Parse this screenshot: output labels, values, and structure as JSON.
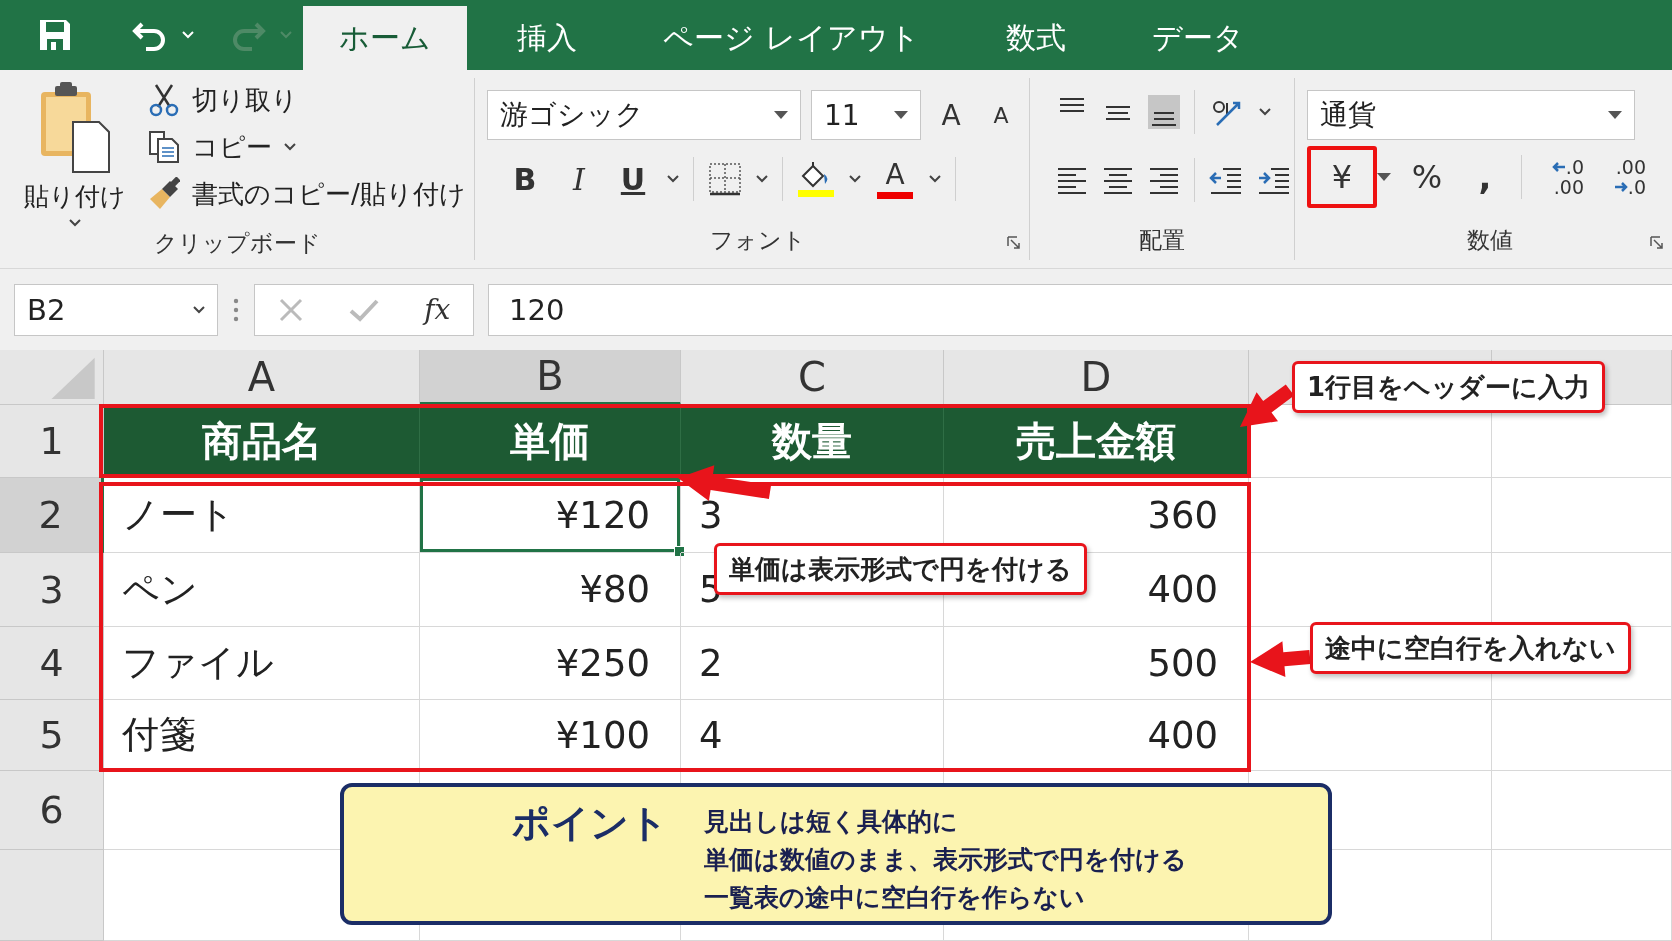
{
  "quick_access": [
    {
      "kind": "save",
      "disabled": false
    },
    {
      "kind": "undo",
      "disabled": false
    },
    {
      "kind": "redo",
      "disabled": true
    }
  ],
  "tabs": [
    {
      "label": "ホーム",
      "selected": true
    },
    {
      "label": "挿入",
      "selected": false
    },
    {
      "label": "ページ レイアウト",
      "selected": false
    },
    {
      "label": "数式",
      "selected": false
    },
    {
      "label": "データ",
      "selected": false
    }
  ],
  "ribbon": {
    "clipboard": {
      "paste": "貼り付け",
      "label": "クリップボード",
      "items": [
        {
          "kind": "cut",
          "label": "切り取り",
          "dropdown": false
        },
        {
          "kind": "copy",
          "label": "コピー",
          "dropdown": true
        },
        {
          "kind": "painter",
          "label": "書式のコピー/貼り付け",
          "dropdown": false
        }
      ]
    },
    "font": {
      "label": "フォント",
      "name": "游ゴシック",
      "size": "11",
      "grow": "A",
      "shrink": "A",
      "bold": "B",
      "italic": "I",
      "underline": "U",
      "font_color_letter": "A"
    },
    "alignment": {
      "label": "配置",
      "vertical": [
        {
          "kind": "top",
          "selected": false
        },
        {
          "kind": "middle",
          "selected": false
        },
        {
          "kind": "bottom",
          "selected": true
        }
      ],
      "horizontal": [
        {
          "kind": "left",
          "selected": false
        },
        {
          "kind": "center",
          "selected": false
        },
        {
          "kind": "right",
          "selected": false
        }
      ]
    },
    "number": {
      "label": "数値",
      "format": "通貨",
      "currency": "¥",
      "currency_highlighted": true,
      "percent": "%",
      "comma": ",",
      "decimals": [
        {
          "kind": "increase",
          "top": ".0",
          "bottom": ".00"
        },
        {
          "kind": "decrease",
          "top": ".00",
          "bottom": ".0"
        }
      ]
    }
  },
  "formula_bar": {
    "cell": "B2",
    "fx": "fx",
    "value": "120"
  },
  "sheet": {
    "columns": [
      {
        "label": "A",
        "selected": false,
        "right_aligned": false
      },
      {
        "label": "B",
        "selected": true,
        "right_aligned": true
      },
      {
        "label": "C",
        "selected": false,
        "right_aligned": false
      },
      {
        "label": "D",
        "selected": false,
        "right_aligned": true
      }
    ],
    "rows": [
      {
        "label": "1",
        "selected": false,
        "kind": "header",
        "cells": [
          "商品名",
          "単価",
          "数量",
          "売上金額"
        ]
      },
      {
        "label": "2",
        "selected": true,
        "kind": "data",
        "cells": [
          "ノート",
          "¥120",
          "3",
          "360"
        ]
      },
      {
        "label": "3",
        "selected": false,
        "kind": "data",
        "cells": [
          "ペン",
          "¥80",
          "5",
          "400"
        ]
      },
      {
        "label": "4",
        "selected": false,
        "kind": "data",
        "cells": [
          "ファイル",
          "¥250",
          "2",
          "500"
        ]
      },
      {
        "label": "5",
        "selected": false,
        "kind": "data",
        "cells": [
          "付箋",
          "¥100",
          "4",
          "400"
        ]
      },
      {
        "label": "6",
        "selected": false,
        "kind": "empty"
      }
    ]
  },
  "callouts": [
    {
      "text": "1行目をヘッダーに入力"
    },
    {
      "text": "単価は表示形式で円を付ける"
    },
    {
      "text": "途中に空白行を入れない"
    }
  ],
  "point": {
    "title": "ポイント",
    "lines": [
      "見出しは短く具体的に",
      "単価は数値のまま、表示形式で円を付ける",
      "一覧表の途中に空白行を作らない"
    ]
  }
}
